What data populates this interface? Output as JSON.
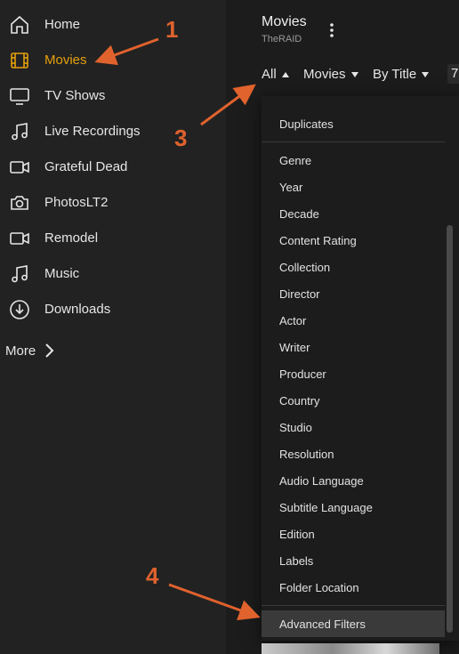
{
  "sidebar": {
    "items": [
      {
        "label": "Home",
        "icon": "home-icon"
      },
      {
        "label": "Movies",
        "icon": "film-icon",
        "active": true
      },
      {
        "label": "TV Shows",
        "icon": "tv-icon"
      },
      {
        "label": "Live Recordings",
        "icon": "music-note-icon"
      },
      {
        "label": "Grateful Dead",
        "icon": "video-camera-icon"
      },
      {
        "label": "PhotosLT2",
        "icon": "camera-icon"
      },
      {
        "label": "Remodel",
        "icon": "video-camera-icon"
      },
      {
        "label": "Music",
        "icon": "music-note-icon"
      },
      {
        "label": "Downloads",
        "icon": "download-icon"
      }
    ],
    "more_label": "More"
  },
  "header": {
    "title": "Movies",
    "subtitle": "TheRAID"
  },
  "toolbar": {
    "filter_all": "All",
    "filter_type": "Movies",
    "sort": "By Title",
    "count": "7"
  },
  "dropdown": {
    "top_item": "Duplicates",
    "items": [
      "Genre",
      "Year",
      "Decade",
      "Content Rating",
      "Collection",
      "Director",
      "Actor",
      "Writer",
      "Producer",
      "Country",
      "Studio",
      "Resolution",
      "Audio Language",
      "Subtitle Language",
      "Edition",
      "Labels",
      "Folder Location"
    ],
    "bottom_item": "Advanced Filters"
  },
  "annotations": [
    "1",
    "3",
    "4"
  ],
  "colors": {
    "accent": "#e5a00d",
    "annotation": "#e0622d",
    "sidebar_bg": "#222222",
    "main_bg": "#1c1c1c"
  }
}
